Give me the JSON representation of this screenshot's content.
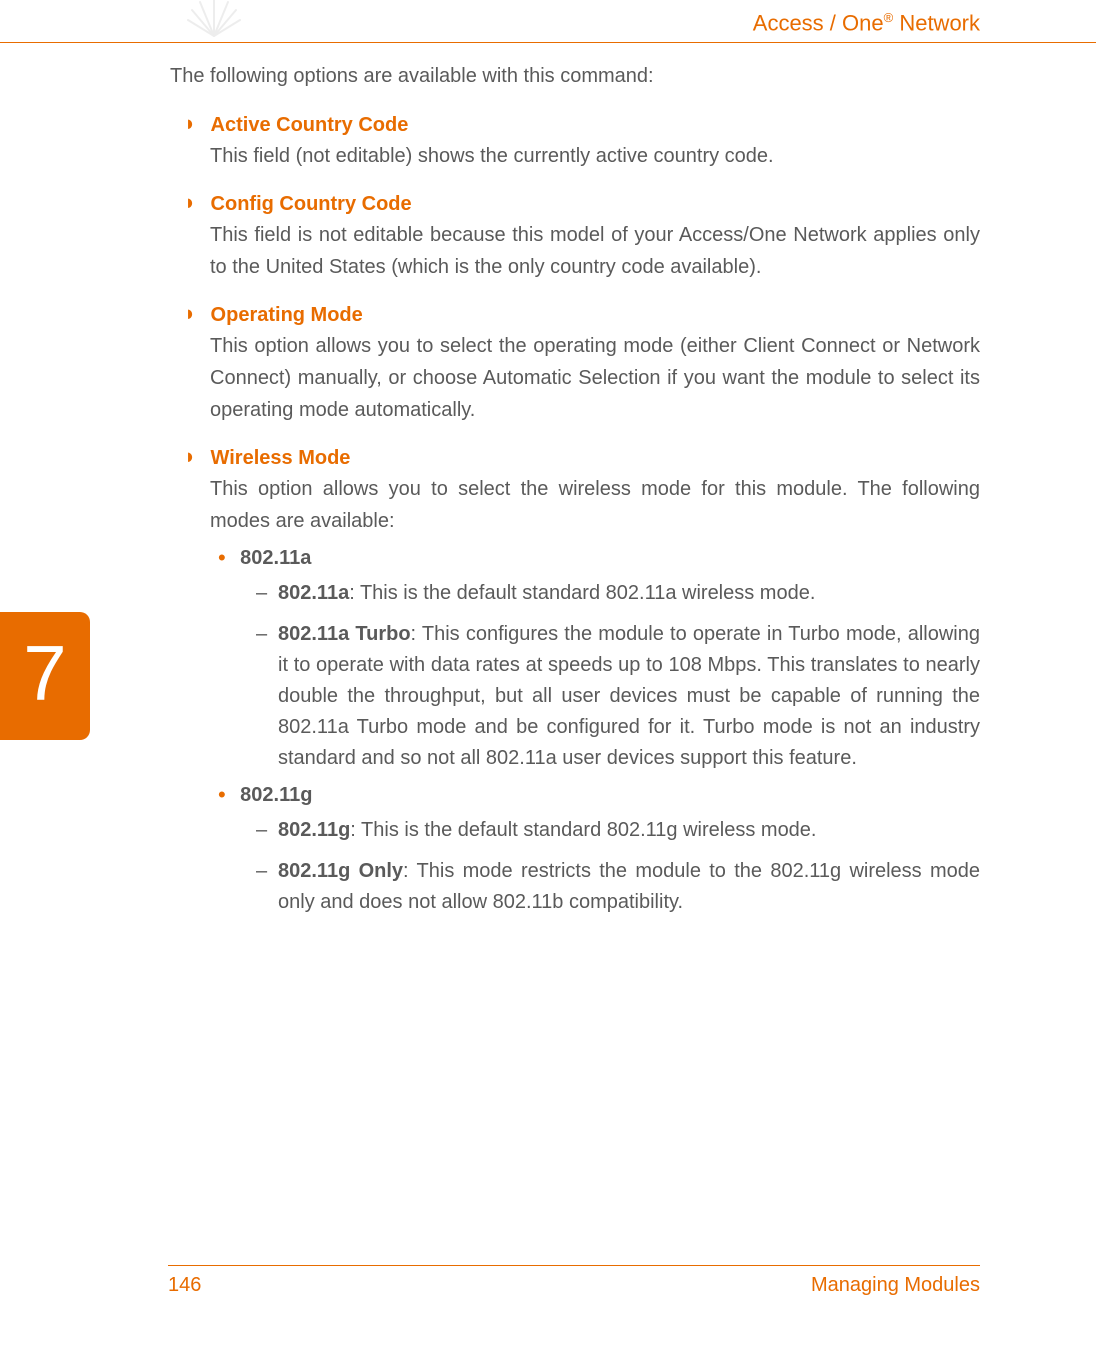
{
  "header": {
    "title_prefix": "Access / One",
    "title_reg": "®",
    "title_suffix": " Network"
  },
  "chapter": "7",
  "intro": "The following options are available with this command:",
  "options": [
    {
      "title": "Active Country Code",
      "desc": "This field (not editable) shows the currently active country code.",
      "justify": false
    },
    {
      "title": "Config Country Code",
      "desc": "This field is not editable because this model of your Access/One Network applies only to the United States (which is the only country code available).",
      "justify": true
    },
    {
      "title": "Operating Mode",
      "desc": "This option allows you to select the operating mode (either Client Connect or Network Connect) manually, or choose Automatic Selection if you want the module to select its operating mode automatically.",
      "justify": true
    },
    {
      "title": "Wireless Mode",
      "desc": "This option allows you to select the wireless mode for this module. The following modes are available:",
      "justify": true,
      "sub": [
        {
          "title": "802.11a",
          "dash": [
            {
              "label": "802.11a",
              "text": ": This is the default standard 802.11a wireless mode."
            },
            {
              "label": "802.11a Turbo",
              "text": ": This configures the module to operate in Turbo mode, allowing it to operate with data rates at speeds up to 108 Mbps. This translates to nearly double the throughput, but all user devices must be capable of running the 802.11a Turbo mode and be configured for it. Turbo mode is not an industry standard and so not all 802.11a user devices support this feature."
            }
          ]
        },
        {
          "title": "802.11g",
          "dash": [
            {
              "label": "802.11g",
              "text": ": This is the default standard 802.11g wireless mode."
            },
            {
              "label": "802.11g Only",
              "text": ": This mode restricts the module to the 802.11g wireless mode only and does not allow 802.11b compatibility."
            }
          ]
        }
      ]
    }
  ],
  "footer": {
    "page": "146",
    "section": "Managing Modules"
  }
}
